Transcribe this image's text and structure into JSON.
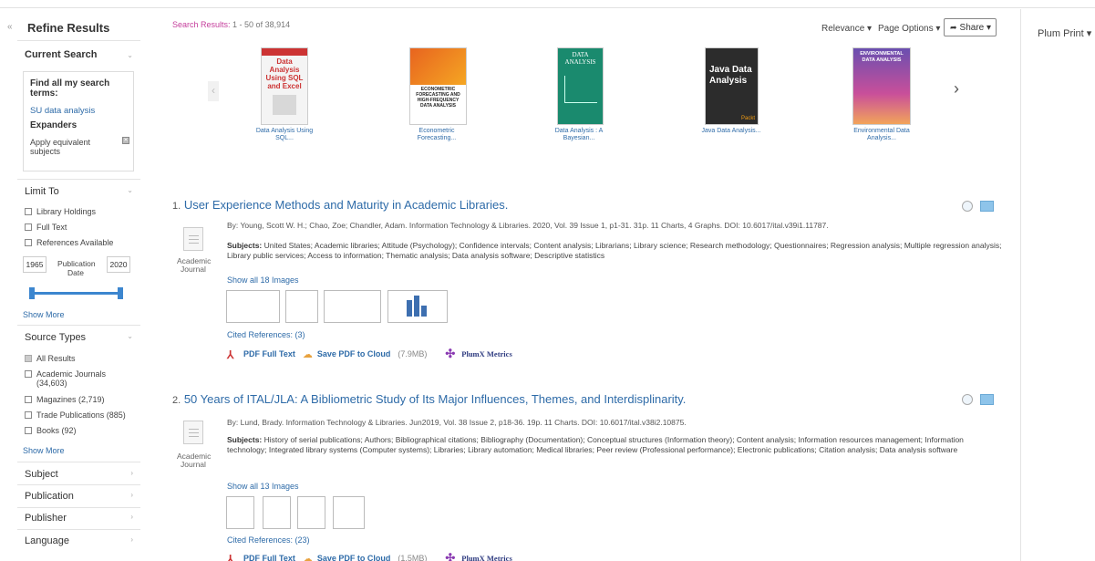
{
  "sidebar": {
    "title": "Refine Results",
    "collapse_glyph": "«",
    "current_search": {
      "heading": "Current Search",
      "find_all": "Find all my search terms:",
      "term": "SU data analysis",
      "expanders": "Expanders",
      "apply": "Apply equivalent subjects"
    },
    "limit_to": {
      "heading": "Limit To",
      "options": [
        "Library Holdings",
        "Full Text",
        "References Available"
      ],
      "date_from": "1965",
      "date_to": "2020",
      "date_label": "Publication Date",
      "show_more": "Show More"
    },
    "source_types": {
      "heading": "Source Types",
      "options": [
        "All Results",
        "Academic Journals (34,603)",
        "Magazines (2,719)",
        "Trade Publications (885)",
        "Books (92)"
      ],
      "show_more": "Show More"
    },
    "facets": [
      "Subject",
      "Publication",
      "Publisher",
      "Language"
    ]
  },
  "header": {
    "results_label": "Search Results:",
    "results_range": "1 - 50 of 38,914",
    "relevance": "Relevance ▾",
    "page_options": "Page Options ▾",
    "share": "Share ▾",
    "plum_print": "Plum Print ▾"
  },
  "carousel": {
    "books": [
      {
        "caption": "Data Analysis Using SQL...",
        "cover_title": "Data Analysis Using SQL and Excel"
      },
      {
        "caption": "Econometric Forecasting...",
        "cover_title": "ECONOMETRIC FORECASTING AND HIGH-FREQUENCY DATA ANALYSIS"
      },
      {
        "caption": "Data Analysis : A Bayesian...",
        "cover_title": "DATA ANALYSIS"
      },
      {
        "caption": "Java Data Analysis...",
        "cover_title": "Java Data Analysis"
      },
      {
        "caption": "Environmental Data Analysis...",
        "cover_title": "ENVIRONMENTAL DATA ANALYSIS"
      }
    ]
  },
  "results": [
    {
      "num": "1.",
      "title": "User Experience Methods and Maturity in Academic Libraries.",
      "byline": "By: Young, Scott W. H.; Chao, Zoe; Chandler, Adam. Information Technology & Libraries. 2020, Vol. 39 Issue 1, p1-31. 31p. 11 Charts, 4 Graphs. DOI: 10.6017/ital.v39i1.11787.",
      "subjects_label": "Subjects:",
      "subjects": "United States; Academic libraries; Attitude (Psychology); Confidence intervals; Content analysis; Librarians; Library science; Research methodology; Questionnaires; Regression analysis; Multiple regression analysis; Library public services; Access to information; Thematic analysis; Data analysis software; Descriptive statistics",
      "type": "Academic Journal",
      "show_images": "Show all 18 Images",
      "cited": "Cited References: (3)",
      "pdf": "PDF Full Text",
      "save": "Save PDF to Cloud",
      "size": "(7.9MB)",
      "plumx": "PlumX Metrics"
    },
    {
      "num": "2.",
      "title": "50 Years of ITAL/JLA: A Bibliometric Study of Its Major Influences, Themes, and Interdisplinarity.",
      "byline": "By: Lund, Brady. Information Technology & Libraries. Jun2019, Vol. 38 Issue 2, p18-36. 19p. 11 Charts. DOI: 10.6017/ital.v38i2.10875.",
      "subjects_label": "Subjects:",
      "subjects": "History of serial publications; Authors; Bibliographical citations; Bibliography (Documentation); Conceptual structures (Information theory); Content analysis; Information resources management; Information technology; Integrated library systems (Computer systems); Libraries; Library automation; Medical libraries; Peer review (Professional performance); Electronic publications; Citation analysis; Data analysis software",
      "type": "Academic Journal",
      "show_images": "Show all 13 Images",
      "cited": "Cited References: (23)",
      "pdf": "PDF Full Text",
      "save": "Save PDF to Cloud",
      "size": "(1.5MB)",
      "plumx": "PlumX Metrics"
    }
  ]
}
